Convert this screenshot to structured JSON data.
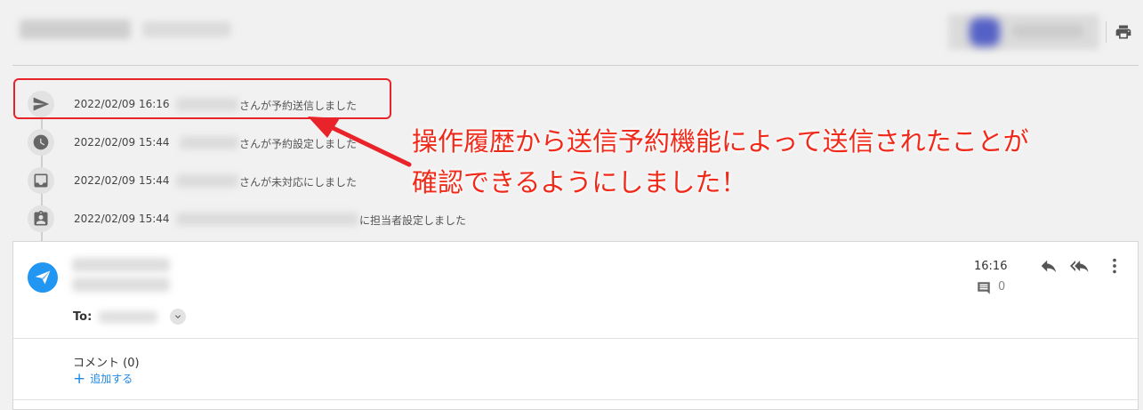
{
  "header": {
    "print_icon": "printer-icon"
  },
  "timeline": [
    {
      "icon": "send-icon",
      "date": "2022/02/09 16:16",
      "text": "さんが予約送信しました"
    },
    {
      "icon": "clock-icon",
      "date": "2022/02/09 15:44",
      "text": "さんが予約設定しました"
    },
    {
      "icon": "inbox-icon",
      "date": "2022/02/09 15:44",
      "text": "さんが未対応にしました"
    },
    {
      "icon": "contact-icon",
      "date": "2022/02/09 15:44",
      "text": "に担当者設定しました"
    }
  ],
  "annotation": {
    "line1": "操作履歴から送信予約機能によって送信されたことが",
    "line2": "確認できるようにしました！",
    "color": "#f02a1a"
  },
  "message": {
    "to_label": "To:",
    "time": "16:16",
    "comment_count": "0",
    "comments_heading": "コメント (0)",
    "add_comment": "追加する",
    "accent": "#2196f3"
  }
}
